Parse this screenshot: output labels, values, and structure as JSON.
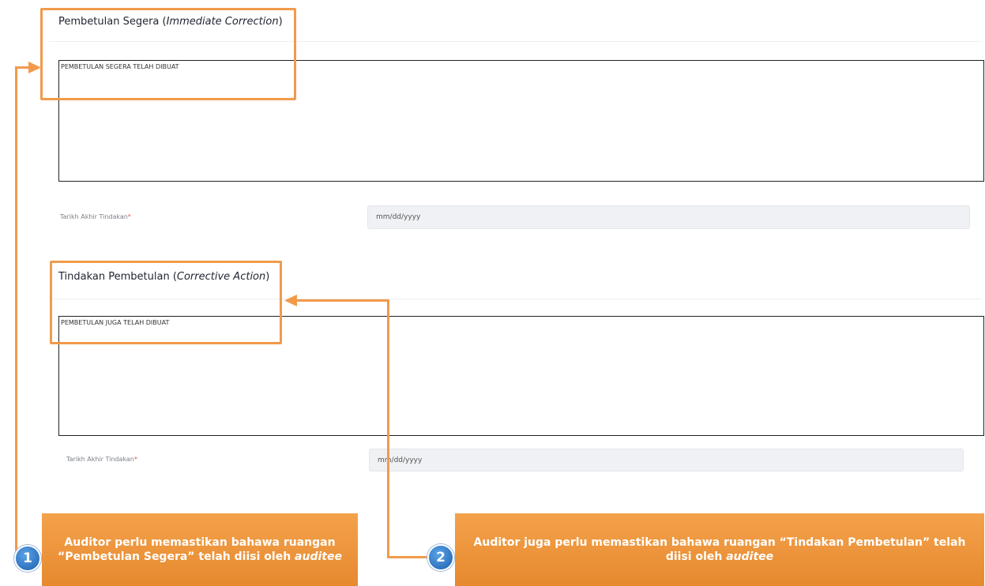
{
  "section1": {
    "title_main": "Pembetulan Segera (",
    "title_italic": "Immediate Correction",
    "title_end": ")",
    "textarea_value": "PEMBETULAN SEGERA TELAH DIBUAT",
    "date_label": "Tarikh Akhir Tindakan",
    "required_mark": "*",
    "date_placeholder": "mm/dd/yyyy"
  },
  "section2": {
    "title_main": "Tindakan Pembetulan (",
    "title_italic": "Corrective Action",
    "title_end": ")",
    "textarea_value": "PEMBETULAN JUGA TELAH DIBUAT",
    "date_label": "Tarikh Akhir Tindakan",
    "required_mark": "*",
    "date_placeholder": "mm/dd/yyyy"
  },
  "callouts": [
    {
      "badge": "1",
      "text_pre": "Auditor perlu memastikan bahawa ruangan “Pembetulan Segera” telah diisi oleh ",
      "text_italic": "auditee"
    },
    {
      "badge": "2",
      "text_pre": "Auditor juga perlu memastikan bahawa  ruangan “Tindakan Pembetulan” telah diisi oleh ",
      "text_italic": "auditee"
    }
  ],
  "colors": {
    "highlight": "#f29a4a",
    "badge": "#1c5fae",
    "required": "#e05252"
  }
}
